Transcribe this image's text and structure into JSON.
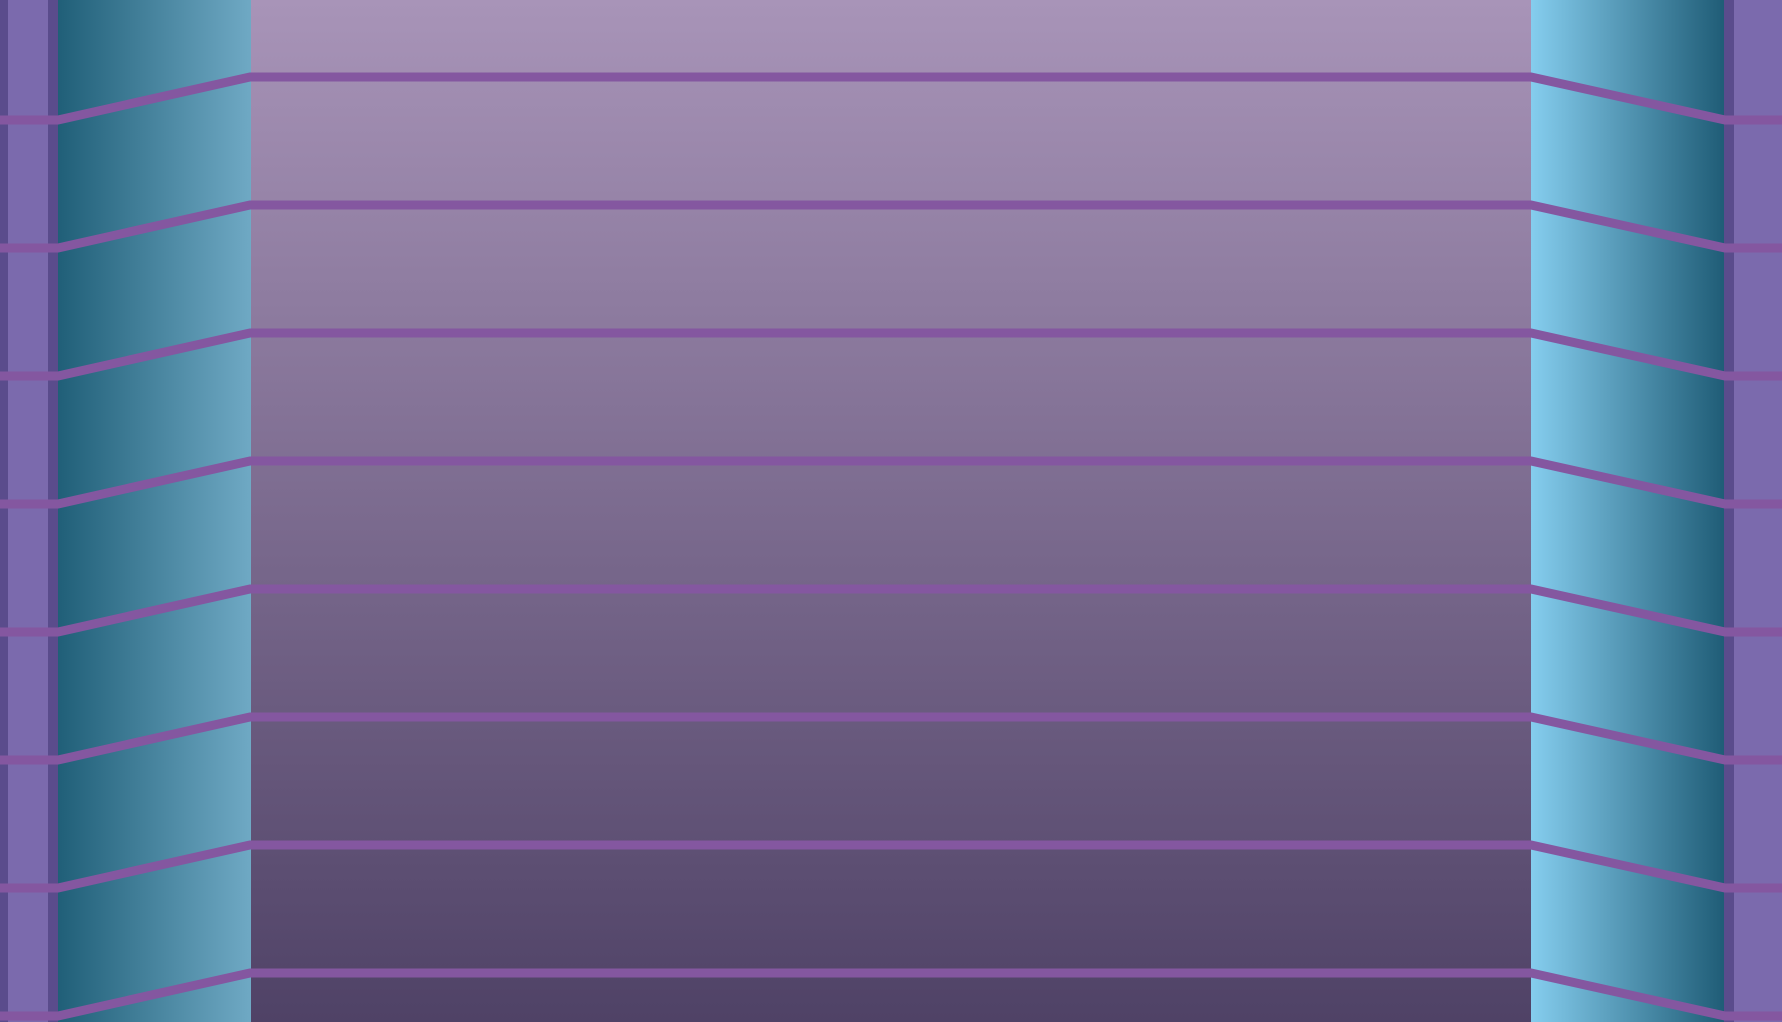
{
  "colors": {
    "floor_top": "#a894b8",
    "floor_bottom": "#4f4266",
    "grid_line": "#8457a0",
    "left_wall_dark": "#205f78",
    "left_wall_light": "#6fa9c4",
    "right_wall_light": "#85cdee",
    "right_wall_dark": "#1f5c76",
    "pillar": "#7b6aad",
    "pillar_edge": "#5a4c8c"
  },
  "scene": {
    "row_count": 8
  }
}
